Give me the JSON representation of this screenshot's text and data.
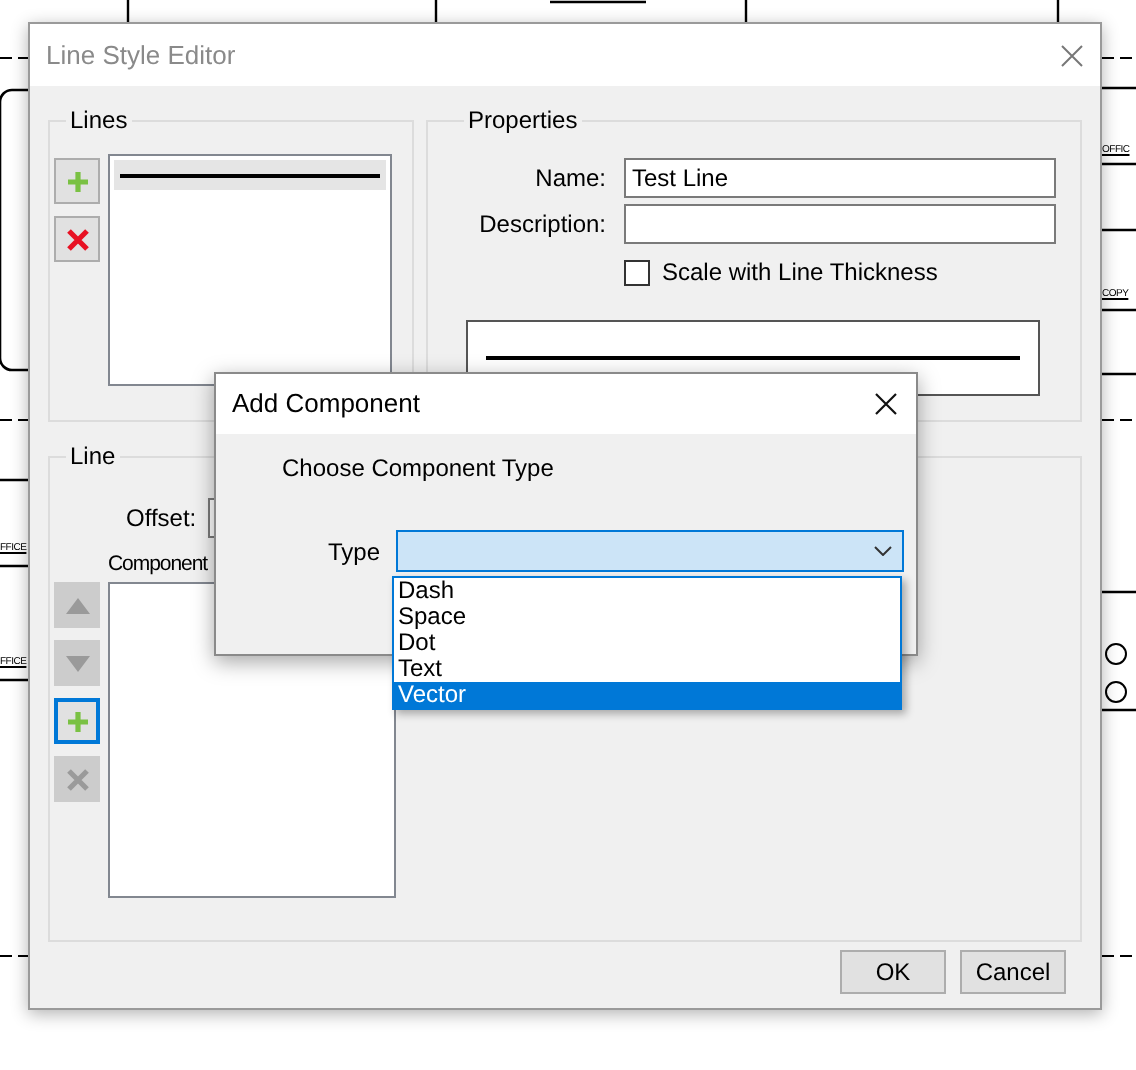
{
  "window": {
    "title": "Line Style Editor"
  },
  "lines_group": {
    "title": "Lines",
    "buttons": [
      {
        "kind": "add",
        "disabled": false,
        "focused": false
      },
      {
        "kind": "delete",
        "disabled": false,
        "focused": false
      }
    ],
    "items": [
      {
        "selected": true
      }
    ]
  },
  "properties": {
    "title": "Properties",
    "name_label": "Name:",
    "name_value": "Test Line",
    "description_label": "Description:",
    "scale_checkbox": {
      "label": "Scale with Line Thickness",
      "checked": false
    }
  },
  "line_group": {
    "title": "Line",
    "offset_label": "Offset:",
    "components_label": "Component",
    "buttons": [
      {
        "kind": "up",
        "disabled": true,
        "focused": false
      },
      {
        "kind": "down",
        "disabled": true,
        "focused": false
      },
      {
        "kind": "add",
        "disabled": false,
        "focused": true
      },
      {
        "kind": "delete",
        "disabled": true,
        "focused": false
      }
    ]
  },
  "buttons": [
    "OK",
    "Cancel"
  ],
  "dialog": {
    "title": "Add Component",
    "heading": "Choose Component Type",
    "type_label": "Type",
    "options": [
      {
        "label": "Dash",
        "selected": false
      },
      {
        "label": "Space",
        "selected": false
      },
      {
        "label": "Dot",
        "selected": false
      },
      {
        "label": "Text",
        "selected": false
      },
      {
        "label": "Vector",
        "selected": true
      }
    ]
  },
  "background_labels": [
    "OFFIC",
    "COPY",
    "FFICE",
    "FFICE"
  ]
}
